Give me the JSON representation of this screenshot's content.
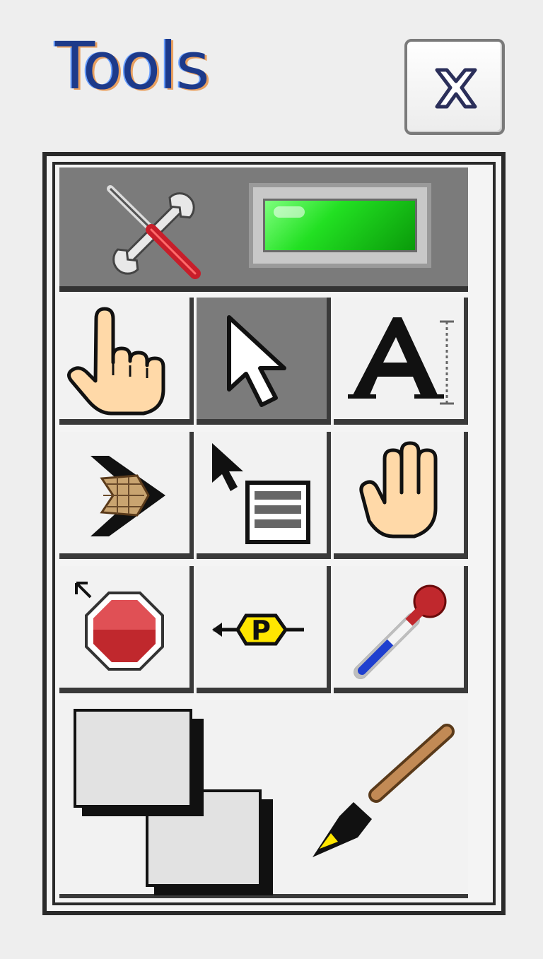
{
  "window": {
    "title": "Tools"
  },
  "tools": {
    "automatic_label": "automatic-tool-selection",
    "items": [
      {
        "name": "operate-value-tool",
        "icon": "pointing-hand-icon"
      },
      {
        "name": "position-size-select-tool",
        "icon": "arrow-cursor-icon",
        "selected": true
      },
      {
        "name": "edit-text-tool",
        "icon": "text-a-icon"
      },
      {
        "name": "connect-wire-tool",
        "icon": "wire-spool-icon"
      },
      {
        "name": "object-shortcut-menu-tool",
        "icon": "arrow-menu-icon"
      },
      {
        "name": "scroll-window-tool",
        "icon": "open-hand-icon"
      },
      {
        "name": "set-clear-breakpoint-tool",
        "icon": "stop-sign-icon"
      },
      {
        "name": "probe-data-tool",
        "icon": "probe-p-icon"
      },
      {
        "name": "get-color-tool",
        "icon": "eyedropper-icon"
      }
    ],
    "set_color": {
      "icon": "paintbrush-icon",
      "foreground": "#e2e2e2",
      "background": "#e2e2e2"
    }
  },
  "colors": {
    "led_on": "#22e022",
    "breakpoint": "#c0282d",
    "probe": "#ffe600"
  }
}
